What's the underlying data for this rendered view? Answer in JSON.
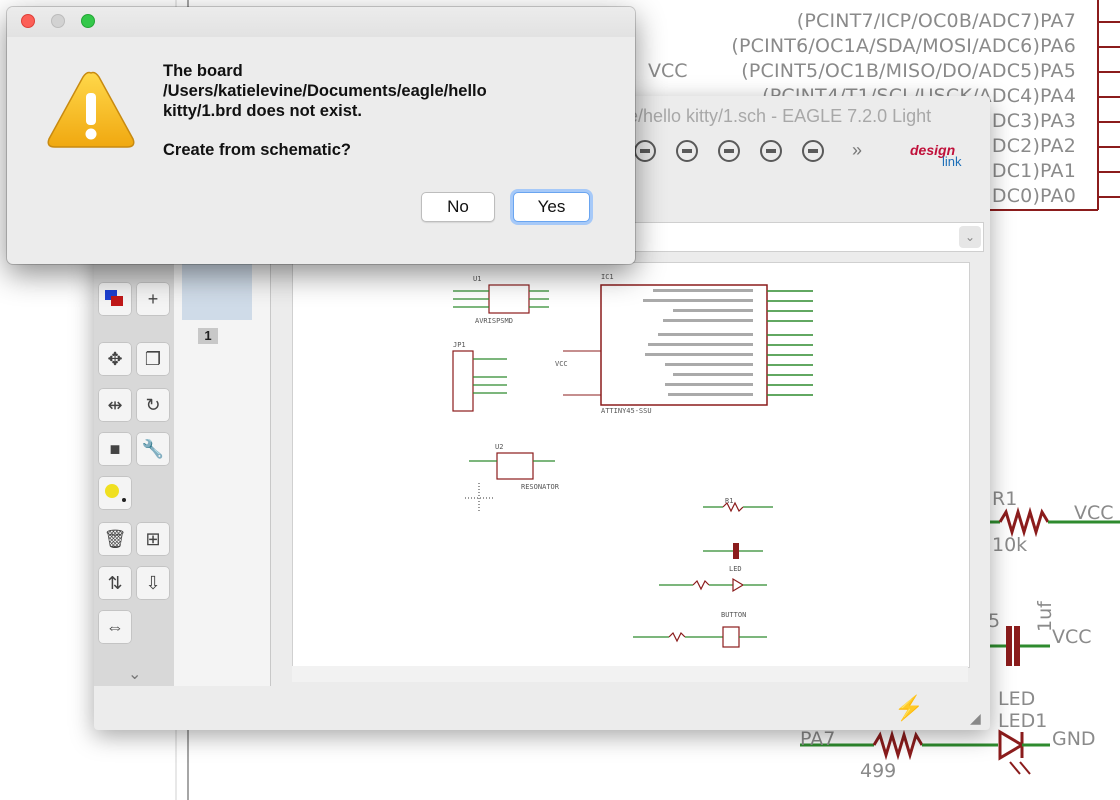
{
  "background": {
    "pin_labels": [
      "(PCINT7/ICP/OC0B/ADC7)PA7",
      "(PCINT6/OC1A/SDA/MOSI/ADC6)PA6",
      "(PCINT5/OC1B/MISO/DO/ADC5)PA5",
      "(PCINT4/T1/SCL/USCK/ADC4)PA4",
      "DC3)PA3",
      "DC2)PA2",
      "DC1)PA1",
      "DC0)PA0"
    ],
    "vcc_label": "VCC",
    "r1_label": "R1",
    "r1_value": "10k",
    "vcc_right_1": "VCC",
    "cap_value": "1uf",
    "cap_prefix": "5",
    "vcc_right_2": "VCC",
    "led_label": "LED",
    "led1_label": "LED1",
    "pa7_label": "PA7",
    "gnd_label": "GND",
    "r_value_499": "499"
  },
  "eagle": {
    "title": "le/hello kitty/1.sch - EAGLE 7.2.0 Light",
    "designlink_top": "design",
    "designlink_bottom": "link",
    "sheet_number": "1"
  },
  "dialog": {
    "message_line1": "The board",
    "message_line2": "/Users/katielevine/Documents/eagle/hello",
    "message_line3": "kitty/1.brd does not exist.",
    "question": "Create from schematic?",
    "no_label": "No",
    "yes_label": "Yes"
  },
  "schematic": {
    "ic1": "IC1",
    "u1": "U1",
    "avrisp": "AVRISPSMD",
    "jp1": "JP1",
    "u2": "U2",
    "resonator": "RESONATOR",
    "attiny": "ATTINY45-SSU",
    "vcc": "VCC",
    "gnd": "GND",
    "led": "LED",
    "button": "BUTTON",
    "r1": "R1",
    "r2": "R2"
  }
}
